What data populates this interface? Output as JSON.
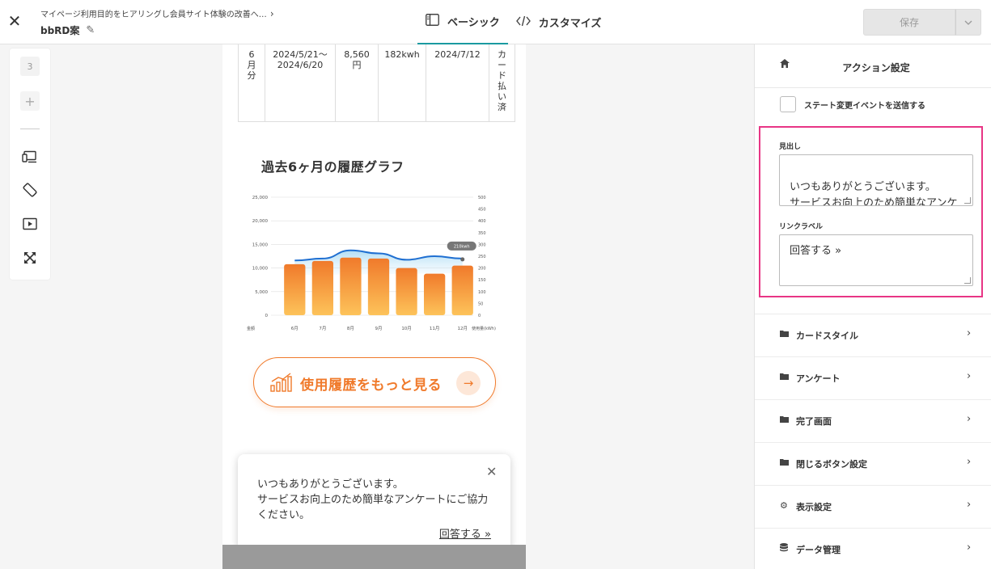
{
  "header": {
    "breadcrumb": "マイページ利用目的をヒアリングし会員サイト体験の改善へ…",
    "project_name": "bbRD案",
    "modes": [
      {
        "label": "ベーシック",
        "icon": "layout-icon",
        "active": true
      },
      {
        "label": "カスタマイズ",
        "icon": "code-icon",
        "active": false
      }
    ],
    "save_label": "保存"
  },
  "left_toolbar": {
    "page_number": "3",
    "add_label": "+",
    "tools": [
      "devices-icon",
      "rotate-icon",
      "play-icon",
      "expand-icon"
    ]
  },
  "preview": {
    "bill_row": {
      "month": "6\n月\n分",
      "period": "2024/5/21〜\n2024/6/20",
      "amount": "8,560\n円",
      "usage": "182kwh",
      "date": "2024/7/12",
      "status": "カ\nー\nド\n払\nい\n済"
    },
    "graph_title": "過去6ヶ月の履歴グラフ",
    "history_button": "使用履歴をもっと見る",
    "popup": {
      "text": "いつもありがとうございます。\nサービスお向上のため簡単なアンケートにご協力ください。",
      "link": "回答する »"
    }
  },
  "chart_data": {
    "type": "bar",
    "categories": [
      "6月",
      "7月",
      "8月",
      "9月",
      "10月",
      "11月",
      "12月"
    ],
    "series": [
      {
        "name": "金額",
        "values": [
          10800,
          11500,
          12200,
          12000,
          10000,
          8800,
          10500
        ],
        "color": "#f07a2b"
      },
      {
        "name": "使用量(kWh)",
        "values": [
          232,
          240,
          275,
          262,
          235,
          250,
          240
        ],
        "color": "#1f6fd1"
      }
    ],
    "y_left_ticks": [
      "25,000",
      "20,000",
      "15,000",
      "10,000",
      "5,000",
      "0"
    ],
    "y_right_ticks": [
      "500",
      "450",
      "400",
      "350",
      "300",
      "250",
      "200",
      "150",
      "100",
      "50",
      "0"
    ],
    "ylim": [
      0,
      25000
    ],
    "y2lim": [
      0,
      500
    ],
    "xlabel_left": "金額",
    "xlabel_right": "使用量(kWh)",
    "tooltip": "210kwh"
  },
  "right_panel": {
    "title": "アクション設定",
    "checkbox_label": "ステート変更イベントを送信する",
    "headline_label": "見出し",
    "headline_value": "いつもありがとうございます。\nサービスお向上のため簡単なアンケートにご協力ください。",
    "link_label_label": "リンクラベル",
    "link_label_value": "回答する »",
    "sections": [
      {
        "label": "カードスタイル",
        "icon": "folder-icon"
      },
      {
        "label": "アンケート",
        "icon": "folder-icon"
      },
      {
        "label": "完了画面",
        "icon": "folder-icon"
      },
      {
        "label": "閉じるボタン設定",
        "icon": "folder-icon"
      },
      {
        "label": "表示設定",
        "icon": "gear-icon"
      },
      {
        "label": "データ管理",
        "icon": "database-icon"
      }
    ]
  },
  "colors": {
    "accent": "#1a9aa0",
    "highlight": "#e83585",
    "orange": "#f07a2b"
  }
}
